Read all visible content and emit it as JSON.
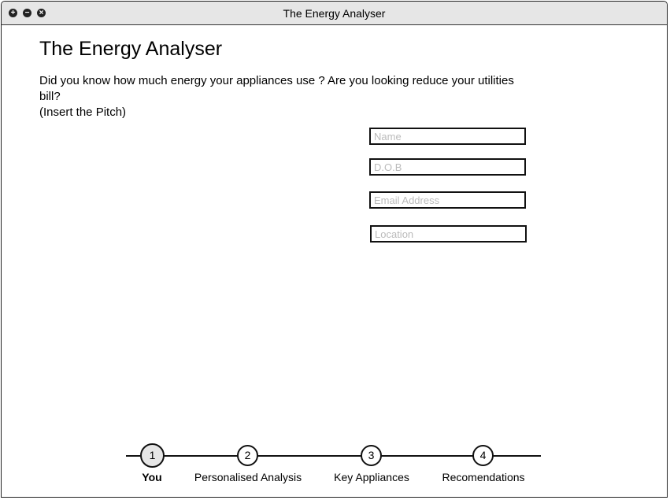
{
  "window": {
    "title": "The Energy Analyser"
  },
  "header": {
    "title": "The Energy Analyser",
    "pitch_line1": "Did you know how much energy your appliances use ? Are you looking reduce your utilities bill?",
    "pitch_line2": "(Insert the Pitch)"
  },
  "form": {
    "name_placeholder": "Name",
    "dob_placeholder": "D.O.B",
    "email_placeholder": "Email Address",
    "location_placeholder": "Location"
  },
  "steps": [
    {
      "num": "1",
      "label": "You",
      "active": true
    },
    {
      "num": "2",
      "label": "Personalised Analysis"
    },
    {
      "num": "3",
      "label": "Key Appliances"
    },
    {
      "num": "4",
      "label": "Recomendations"
    }
  ]
}
